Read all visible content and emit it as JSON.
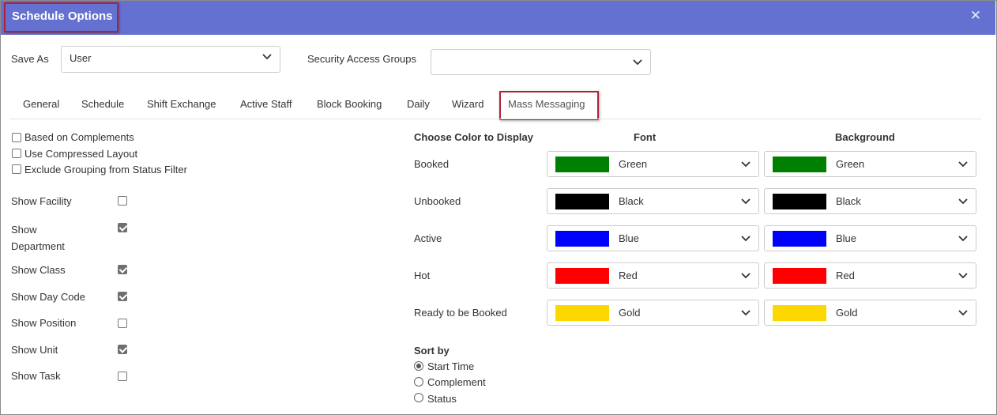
{
  "window": {
    "title": "Schedule Options"
  },
  "save_as": {
    "label": "Save As",
    "value": "User"
  },
  "security": {
    "label": "Security Access Groups",
    "value": ""
  },
  "tabs": [
    {
      "label": "General"
    },
    {
      "label": "Schedule"
    },
    {
      "label": "Shift Exchange"
    },
    {
      "label": "Active Staff"
    },
    {
      "label": "Block Booking"
    },
    {
      "label": "Daily"
    },
    {
      "label": "Wizard"
    },
    {
      "label": "Mass Messaging",
      "active": true
    }
  ],
  "options": [
    {
      "label": "Based on Complements",
      "checked": false
    },
    {
      "label": "Use Compressed Layout",
      "checked": false
    },
    {
      "label": "Exclude Grouping from Status Filter",
      "checked": false
    }
  ],
  "show_items": [
    {
      "label": "Show Facility",
      "checked": false
    },
    {
      "label": "Show Department",
      "checked": true
    },
    {
      "label": "Show Class",
      "checked": true
    },
    {
      "label": "Show Day Code",
      "checked": true
    },
    {
      "label": "Show Position",
      "checked": false
    },
    {
      "label": "Show Unit",
      "checked": true
    },
    {
      "label": "Show Task",
      "checked": false
    }
  ],
  "colors": {
    "header": "Choose Color to Display",
    "font_header": "Font",
    "background_header": "Background",
    "rows": [
      {
        "label": "Booked",
        "font": "Green",
        "background": "Green",
        "font_hex": "#008000",
        "bg_hex": "#008000"
      },
      {
        "label": "Unbooked",
        "font": "Black",
        "background": "Black",
        "font_hex": "#000000",
        "bg_hex": "#000000"
      },
      {
        "label": "Active",
        "font": "Blue",
        "background": "Blue",
        "font_hex": "#0000ff",
        "bg_hex": "#0000ff"
      },
      {
        "label": "Hot",
        "font": "Red",
        "background": "Red",
        "font_hex": "#ff0000",
        "bg_hex": "#ff0000"
      },
      {
        "label": "Ready to be Booked",
        "font": "Gold",
        "background": "Gold",
        "font_hex": "#ffd700",
        "bg_hex": "#ffd700"
      }
    ]
  },
  "sort": {
    "label": "Sort by",
    "options": [
      {
        "label": "Start Time",
        "selected": true
      },
      {
        "label": "Complement",
        "selected": false
      },
      {
        "label": "Status",
        "selected": false
      }
    ]
  },
  "theme": {
    "titlebar": "#6571d1",
    "highlight": "#b0223a"
  },
  "icons": {
    "close": "close-icon",
    "dropdown": "chevron-down-icon"
  }
}
